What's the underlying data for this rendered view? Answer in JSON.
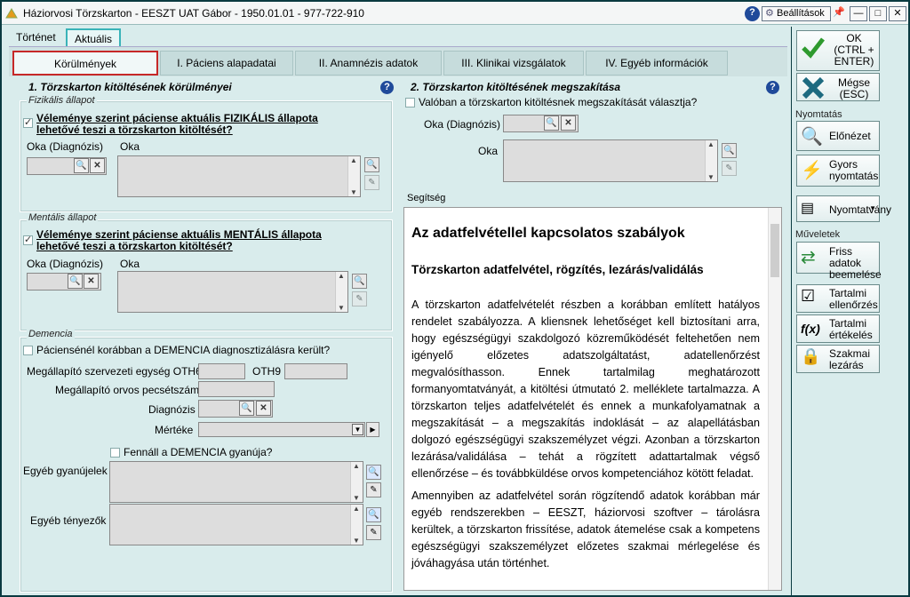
{
  "window": {
    "title": "Háziorvosi Törzskarton - EESZT UAT Gábor - 1950.01.01 - 977-722-910",
    "settings_label": "Beállítások",
    "help_glyph": "?",
    "minimize_glyph": "—",
    "maximize_glyph": "□",
    "close_glyph": "✕"
  },
  "top_tabs": [
    {
      "label": "Történet"
    },
    {
      "label": "Aktuális"
    }
  ],
  "sub_tabs": [
    {
      "label": "Körülmények"
    },
    {
      "label": "I. Páciens alapadatai"
    },
    {
      "label": "II. Anamnézis adatok"
    },
    {
      "label": "III. Klinikai vizsgálatok"
    },
    {
      "label": "IV. Egyéb információk"
    }
  ],
  "left": {
    "title": "1. Törzskarton kitöltésének körülményei",
    "fizikalis": {
      "group": "Fizikális állapot",
      "question": "Véleménye szerint páciense aktuális FIZIKÁLIS állapota lehetővé teszi a törzskarton kitöltését?",
      "oka_diag": "Oka (Diagnózis)",
      "oka": "Oka"
    },
    "mentalis": {
      "group": "Mentális állapot",
      "question": "Véleménye szerint páciense aktuális MENTÁLIS állapota lehetővé teszi a törzskarton kitöltését?",
      "oka_diag": "Oka (Diagnózis)",
      "oka": "Oka"
    },
    "demencia": {
      "group": "Demencia",
      "question": "Páciensénél korábban a DEMENCIA diagnosztizálásra került?",
      "szerv": "Megállapító szervezeti egység OTH6",
      "oth9": "OTH9",
      "orvos": "Megállapító orvos pecsétszám",
      "diagnozis": "Diagnózis",
      "merteke": "Mértéke",
      "gyanu": "Fennáll a DEMENCIA gyanúja?",
      "egyeb_gyanu": "Egyéb gyanújelek",
      "egyeb_tenyezok": "Egyéb tényezők"
    }
  },
  "right": {
    "title": "2. Törzskarton kitöltésének megszakítása",
    "question": "Valóban a törzskarton kitöltésnek megszakítását választja?",
    "oka_diag": "Oka (Diagnózis)",
    "oka": "Oka",
    "help_label": "Segítség",
    "help_h1": "Az adatfelvétellel kapcsolatos szabályok",
    "help_h2": "Törzskarton adatfelvétel, rögzítés, lezárás/validálás",
    "help_p1": "A törzskarton adatfelvételét részben a korábban említett hatályos rendelet szabályozza. A kliensnek lehetőséget kell biztosítani arra, hogy egészségügyi szakdolgozó közreműködését feltehetően nem igényelő előzetes adatszolgáltatást, adatellenőrzést megvalósíthasson. Ennek tartalmilag meghatározott formanyomtatványát, a kitöltési útmutató 2. melléklete tartalmazza. A törzskarton teljes adatfelvételét és ennek a munkafolyamatnak a megszakítását – a megszakítás indoklását – az alapellátásban dolgozó egészségügyi szakszemélyzet végzi. Azonban a törzskarton lezárása/validálása – tehát a rögzített adattartalmak végső ellenőrzése – és továbbküldése orvos kompetenciához kötött feladat.",
    "help_p2": "Amennyiben az adatfelvétel során rögzítendő adatok korábban már egyéb rendszerekben – EESZT, háziorvosi szoftver – tárolásra kerültek, a törzskarton frissítése, adatok átemelése csak a kompetens egészségügyi szakszemélyzet előzetes szakmai mérlegelése és jóváhagyása után történhet."
  },
  "sidebar": {
    "ok": "OK (CTRL + ENTER)",
    "cancel": "Mégse (ESC)",
    "print_section": "Nyomtatás",
    "preview": "Előnézet",
    "quick_print": "Gyors nyomtatás",
    "forms": "Nyomtatvány",
    "ops_section": "Műveletek",
    "refresh": "Friss adatok beemelése",
    "content_check": "Tartalmi ellenőrzés",
    "content_eval": "Tartalmi értékelés",
    "close_prof": "Szakmai lezárás",
    "fx_glyph": "f(x)"
  },
  "colors": {
    "accent": "#3ab3b8",
    "active_outline": "#c62828",
    "background": "#d9ecec"
  }
}
